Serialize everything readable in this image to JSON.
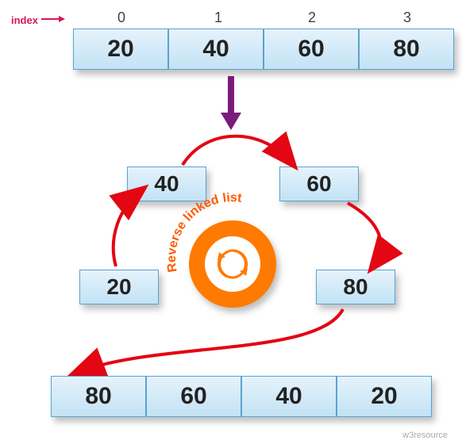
{
  "diagram": {
    "index_label": "index",
    "indices": [
      "0",
      "1",
      "2",
      "3"
    ],
    "top_array": [
      "20",
      "40",
      "60",
      "80"
    ],
    "nodes": {
      "a": "20",
      "b": "40",
      "c": "60",
      "d": "80"
    },
    "center_label": "Reverse linked list",
    "bottom_array": [
      "80",
      "60",
      "40",
      "20"
    ],
    "watermark": "w3resource",
    "colors": {
      "accent_arrow": "#d6165a",
      "flow_arrow": "#e30613",
      "down_arrow": "#7a1c7a",
      "badge": "#ff7a00",
      "cell_border": "#5aa3cf"
    }
  },
  "chart_data": {
    "type": "table",
    "title": "Reverse linked list",
    "input_indices": [
      0,
      1,
      2,
      3
    ],
    "input_values": [
      20,
      40,
      60,
      80
    ],
    "output_values": [
      80,
      60,
      40,
      20
    ],
    "traversal_order": [
      40,
      60,
      80,
      20
    ]
  }
}
